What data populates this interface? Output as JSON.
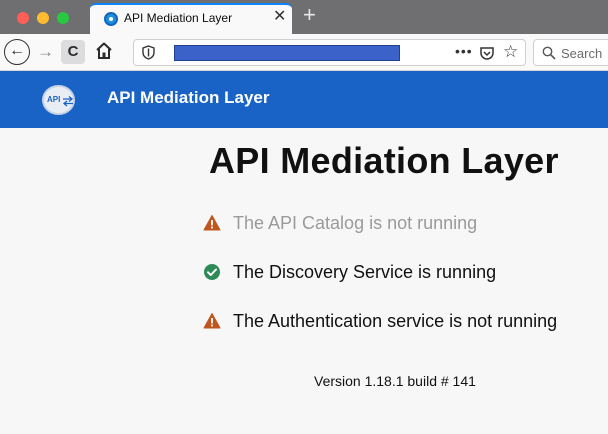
{
  "browser": {
    "tab": {
      "title": "API Mediation Layer",
      "close_glyph": "✕",
      "favicon": "api-mediation-favicon"
    },
    "new_tab_glyph": "+",
    "nav": {
      "back_glyph": "←",
      "forward_glyph": "→",
      "reload_glyph": "C",
      "page_actions_glyph": "•••",
      "star_glyph": "☆"
    },
    "search": {
      "placeholder": "Search"
    }
  },
  "header": {
    "logo_text": "API",
    "title": "API Mediation Layer",
    "background": "#1a63c6"
  },
  "main": {
    "title": "API Mediation Layer",
    "services": [
      {
        "text": "The API Catalog is not running",
        "status": "warning",
        "icon": "warning-icon",
        "color": "#9a9a9a"
      },
      {
        "text": "The Discovery Service is running",
        "status": "ok",
        "icon": "check-circle-icon",
        "color": "#111111"
      },
      {
        "text": "The Authentication service is not running",
        "status": "warning",
        "icon": "warning-icon",
        "color": "#111111"
      }
    ],
    "version": "Version 1.18.1 build # 141"
  },
  "colors": {
    "warning": "#c0561e",
    "success": "#2e8b57"
  }
}
